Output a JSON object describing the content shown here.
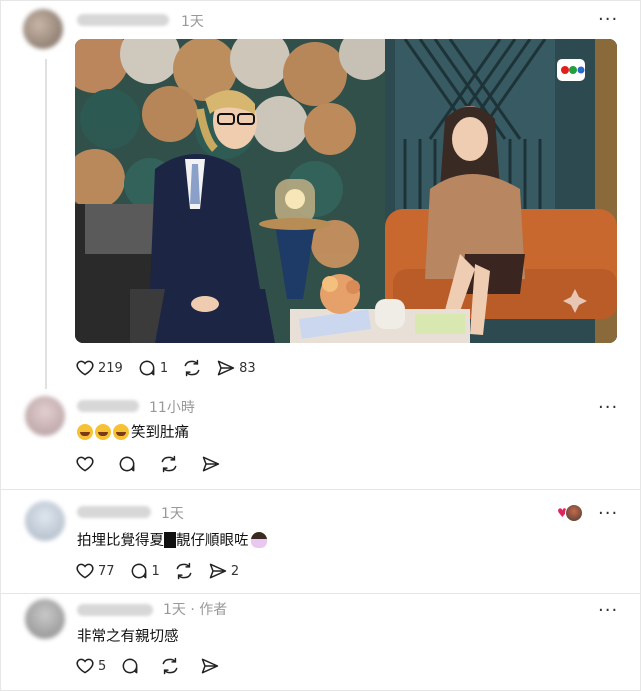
{
  "post": {
    "time": "1天",
    "media_logo": "tvb-logo",
    "stats": {
      "likes": "219",
      "replies": "1",
      "reposts": "",
      "shares": "83"
    }
  },
  "reply1": {
    "time": "11小時",
    "text": "笑到肚痛",
    "emoji_count": 3,
    "stats": {
      "likes": "",
      "replies": "",
      "reposts": "",
      "shares": ""
    }
  },
  "reply2": {
    "time": "1天",
    "text_before": "拍埋比覺得夏",
    "text_after": "靚仔順眼咗",
    "stats": {
      "likes": "77",
      "replies": "1",
      "reposts": "",
      "shares": "2"
    }
  },
  "reply3": {
    "time": "1天",
    "author_tag": "· 作者",
    "text": "非常之有親切感",
    "stats": {
      "likes": "5",
      "replies": "",
      "reposts": "",
      "shares": ""
    }
  },
  "colors": {
    "like_heart": "#e0245e",
    "divider": "#e5e5e5",
    "muted": "#999999"
  },
  "icons": [
    "heart-icon",
    "comment-icon",
    "repost-icon",
    "share-icon",
    "more-icon"
  ]
}
